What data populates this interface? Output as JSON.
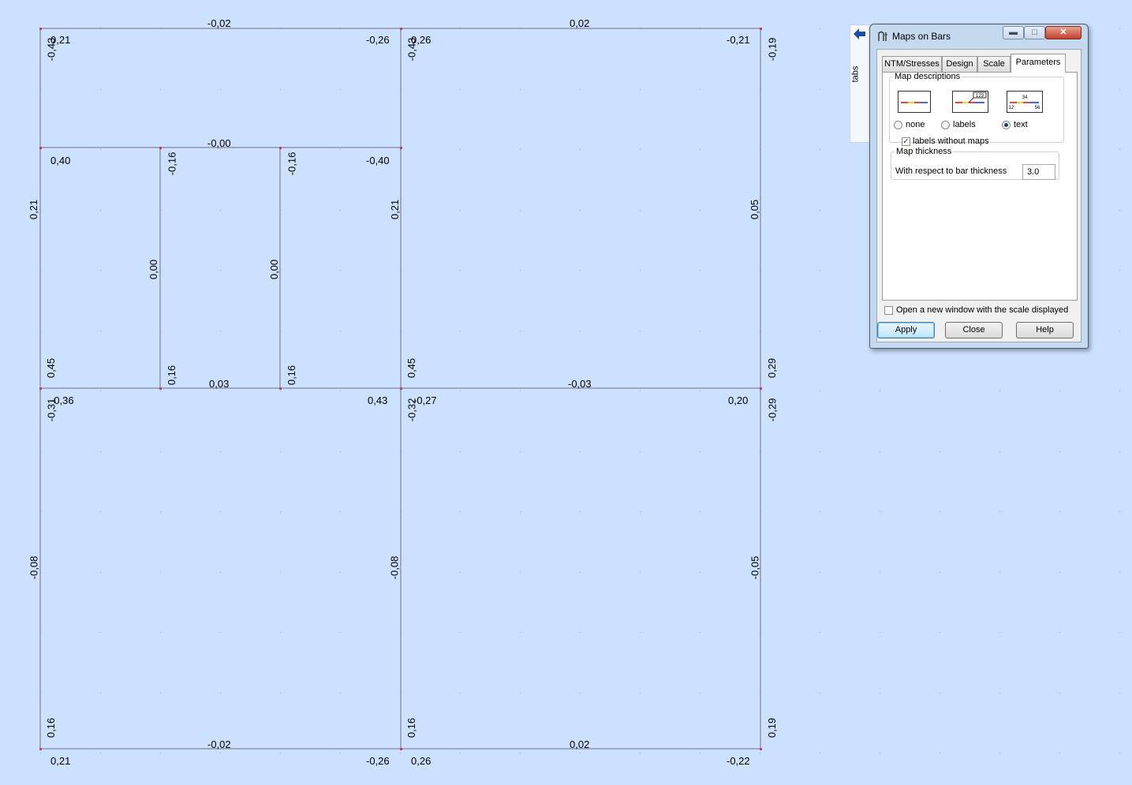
{
  "structure_labels": {
    "top_left_panel": {
      "top_edge": "-0,02",
      "tl_corner": "0,21",
      "tr_corner": "-0,26",
      "left_column_top": "-0,43"
    },
    "top_right_panel": {
      "top_edge": "0,02",
      "tl_corner": "0,26",
      "tr_corner": "-0,21",
      "left_column_top": "-0,43",
      "right_column_top": "-0,19",
      "right_column_mid": "0,05",
      "right_column_bottom": "0,29"
    },
    "inner_beam": {
      "mid": "-0,00",
      "left_end": "0,40",
      "right_end": "-0,40"
    },
    "left_column_upper_mid": "0,21",
    "inner_column_1": {
      "top": "-0,16",
      "mid": "0,00",
      "bottom": "0,16"
    },
    "inner_column_2": {
      "top": "-0,16",
      "mid": "0,00",
      "bottom": "0,16"
    },
    "center_column_upper": {
      "mid": "0,21",
      "bottom": "0,45"
    },
    "left_column_upper_bottom": "0,45",
    "middle_beam": {
      "left_mid": "0,03",
      "right_mid": "-0,03"
    },
    "bottom_left_panel": {
      "tl_corner": "-0,36",
      "tr_corner": "0,43",
      "left_column_top": "-0,31",
      "left_column_mid": "-0,08",
      "left_column_bottom": "0,16",
      "bottom_edge": "-0,02",
      "bl_corner": "0,21",
      "br_corner": "-0,26"
    },
    "bottom_right_panel": {
      "tl_corner": "-0,27",
      "tr_corner": "0,20",
      "left_column_top": "-0,32",
      "left_column_mid": "-0,08",
      "left_column_bottom": "0,16",
      "right_column_top": "-0,29",
      "right_column_mid": "-0,05",
      "right_column_bottom": "0,19",
      "bottom_edge": "0,02",
      "bl_corner": "0,26",
      "br_corner": "-0,22"
    }
  },
  "sidetab": {
    "label": "tabs",
    "icon": "arrow-left-icon"
  },
  "dialog": {
    "title": "Maps on Bars",
    "tabs": [
      "NTM/Stresses",
      "Design",
      "Scale",
      "Parameters"
    ],
    "active_tab": "Parameters",
    "map_descriptions": {
      "legend": "Map descriptions",
      "options": [
        "none",
        "labels",
        "text"
      ],
      "selected": "text",
      "icon2_text": "123",
      "icon3_top": "34",
      "icon3_left": "12",
      "icon3_right": "56",
      "labels_without_maps": {
        "label": "labels without maps",
        "checked": true
      }
    },
    "map_thickness": {
      "legend": "Map thickness",
      "label": "With respect to bar thickness",
      "value": "3.0"
    },
    "open_new_window": {
      "label": "Open a new window with the scale displayed",
      "checked": false
    },
    "buttons": {
      "apply": "Apply",
      "close": "Close",
      "help": "Help"
    }
  },
  "colors": {
    "background": "#cce0ff",
    "grid_dot": "#9aaac0",
    "bar_line": "#7a6a8a",
    "node": "#c04060"
  }
}
